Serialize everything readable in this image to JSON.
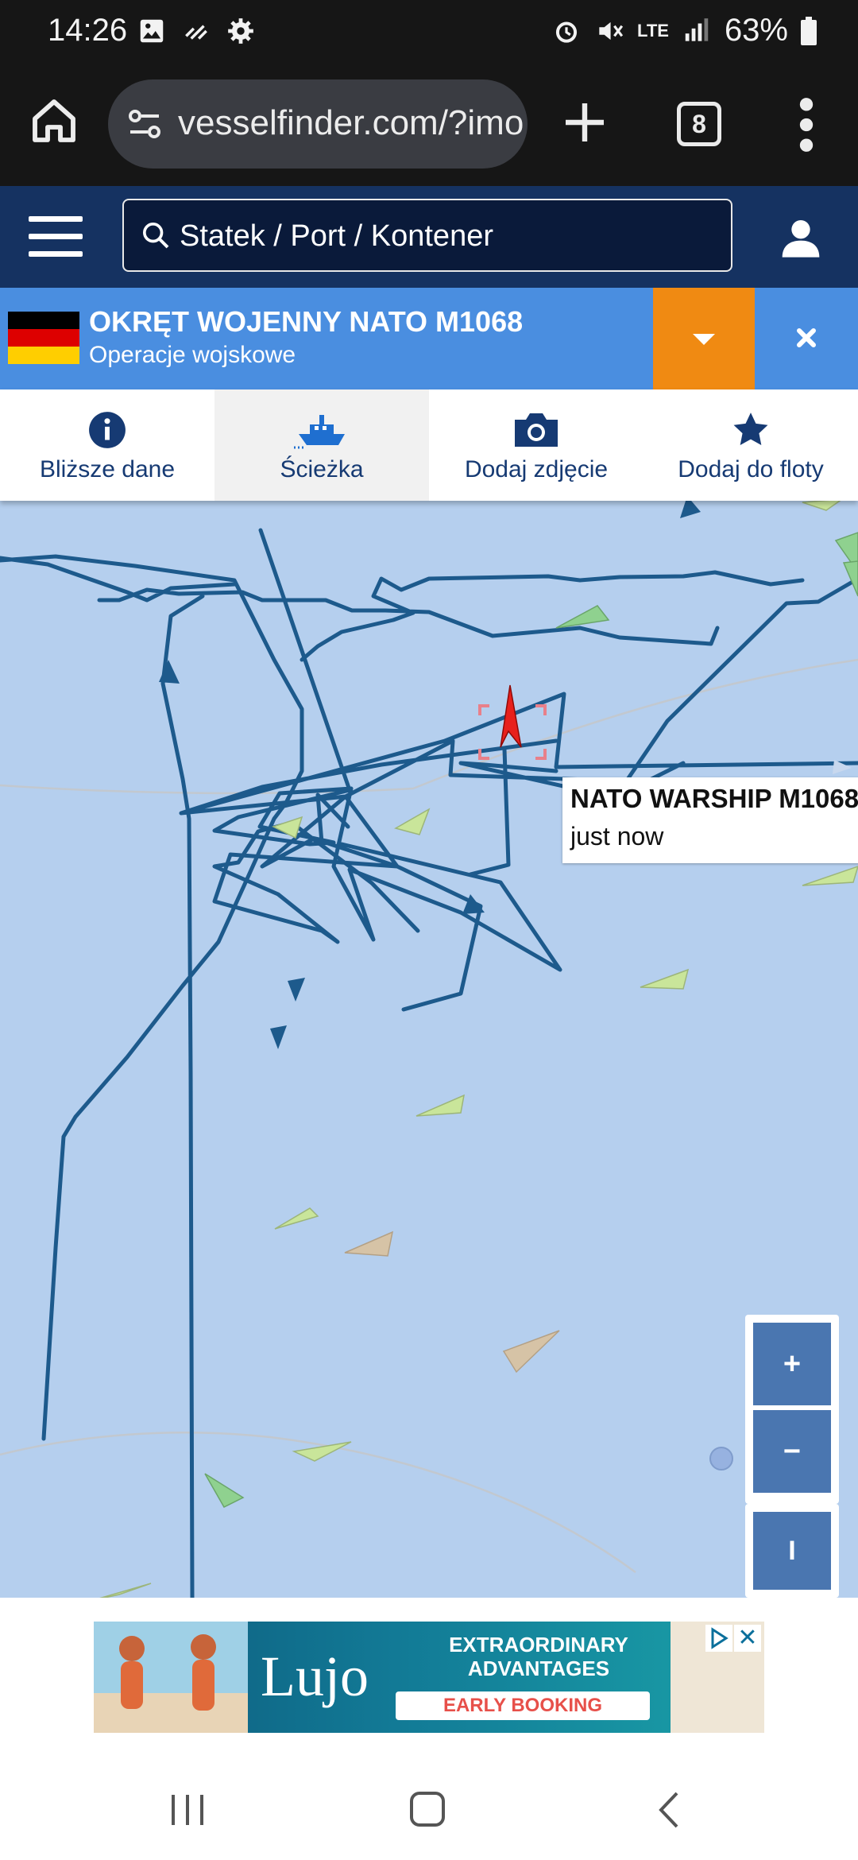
{
  "status_bar": {
    "time": "14:26",
    "network": "LTE",
    "battery": "63%",
    "left_icons": [
      "gallery-icon",
      "data-saver-icon",
      "settings-icon"
    ],
    "right_icons": [
      "alarm-icon",
      "mute-icon",
      "lte-icon",
      "signal-icon",
      "battery-icon"
    ]
  },
  "browser": {
    "url": "vesselfinder.com/?imo",
    "tab_count": "8"
  },
  "site_header": {
    "search_placeholder": "Statek / Port / Kontener"
  },
  "vessel": {
    "name": "OKRĘT WOJENNY NATO M1068",
    "type": "Operacje wojskowe",
    "flag": "Germany"
  },
  "tabs": [
    {
      "label": "Bliższe dane",
      "icon": "info-icon",
      "active": false
    },
    {
      "label": "Ścieżka",
      "icon": "ship-track-icon",
      "active": true
    },
    {
      "label": "Dodaj zdjęcie",
      "icon": "camera-icon",
      "active": false
    },
    {
      "label": "Dodaj do floty",
      "icon": "star-icon",
      "active": false
    }
  ],
  "map": {
    "tooltip_name": "NATO WARSHIP M1068",
    "tooltip_status": "just now",
    "zoom_in_label": "+",
    "zoom_out_label": "−",
    "ruler_label": "I",
    "colors": {
      "water": "#b5cfee",
      "track": "#1d5a8c",
      "selected_vessel": "#e8201c",
      "vessel_green": "#c9e59a",
      "vessel_tan": "#d6c3a6"
    }
  },
  "ad": {
    "brand": "Lujo",
    "headline_line1": "EXTRAORDINARY",
    "headline_line2": "ADVANTAGES",
    "cta": "EARLY BOOKING"
  },
  "nav_bar": {
    "buttons": [
      "recents-icon",
      "home-icon",
      "back-icon"
    ]
  }
}
